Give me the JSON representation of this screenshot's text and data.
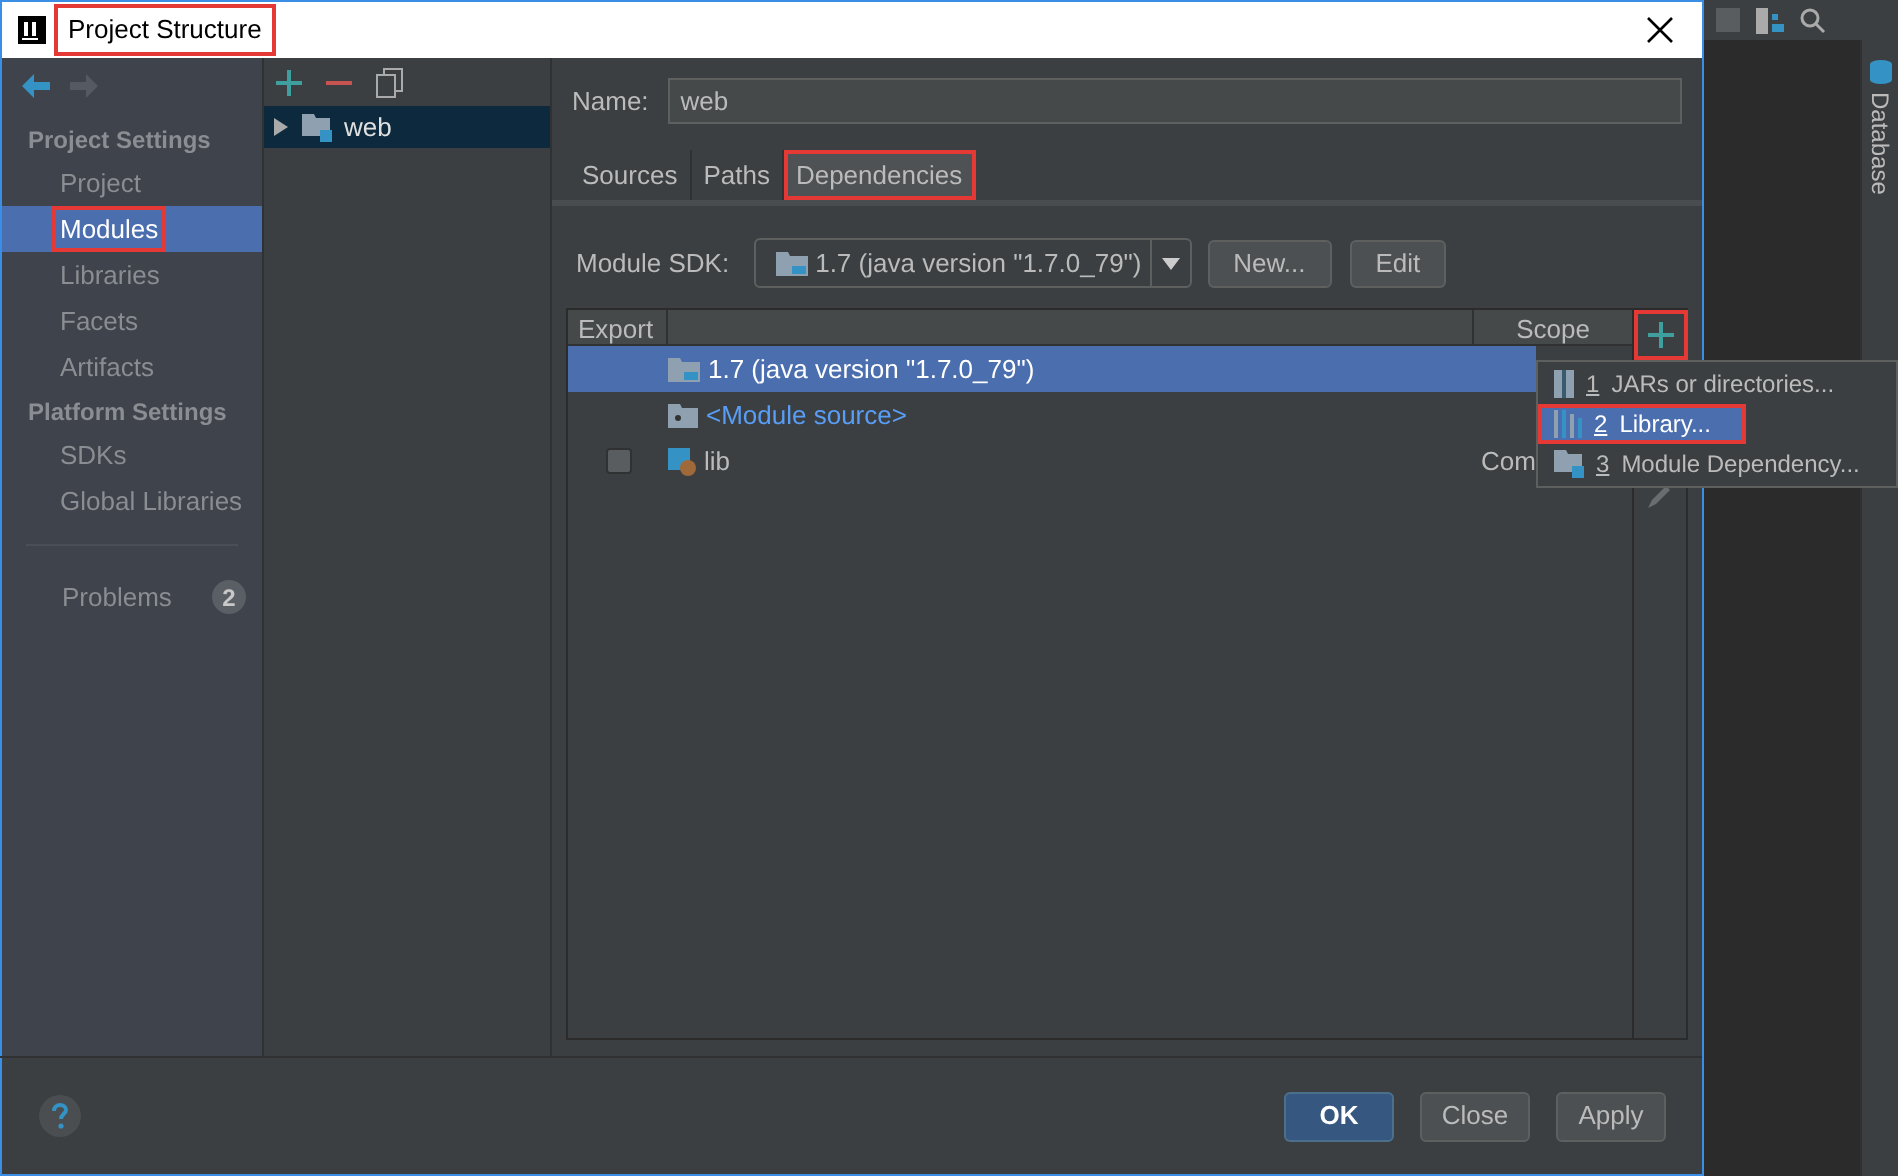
{
  "window": {
    "title": "Project Structure",
    "marked": true
  },
  "sidebar": {
    "sections": [
      {
        "title": "Project Settings",
        "items": [
          {
            "label": "Project",
            "selected": false,
            "marked": false
          },
          {
            "label": "Modules",
            "selected": true,
            "marked": true
          },
          {
            "label": "Libraries",
            "selected": false,
            "marked": false
          },
          {
            "label": "Facets",
            "selected": false,
            "marked": false
          },
          {
            "label": "Artifacts",
            "selected": false,
            "marked": false
          }
        ]
      },
      {
        "title": "Platform Settings",
        "items": [
          {
            "label": "SDKs",
            "selected": false,
            "marked": false
          },
          {
            "label": "Global Libraries",
            "selected": false,
            "marked": false
          }
        ]
      }
    ],
    "problems": {
      "label": "Problems",
      "count": "2"
    }
  },
  "module_tree": [
    {
      "label": "web",
      "expanded": false
    }
  ],
  "name_field": {
    "label": "Name:",
    "value": "web"
  },
  "tabs": [
    {
      "label": "Sources",
      "selected": false,
      "marked": false
    },
    {
      "label": "Paths",
      "selected": false,
      "marked": false
    },
    {
      "label": "Dependencies",
      "selected": true,
      "marked": true
    }
  ],
  "module_sdk": {
    "label": "Module SDK:",
    "value": "1.7 (java version \"1.7.0_79\")"
  },
  "sdk_buttons": [
    "New...",
    "Edit"
  ],
  "table": {
    "columns": [
      "Export",
      "Scope"
    ],
    "add_marked": true,
    "rows": [
      {
        "kind": "sdk",
        "name": "1.7 (java version \"1.7.0_79\")",
        "selected": true
      },
      {
        "kind": "source",
        "name": "<Module source>",
        "selected": false
      },
      {
        "kind": "library",
        "name": "lib",
        "checked": false,
        "scope": "Com",
        "selected": false
      }
    ]
  },
  "add_menu": [
    {
      "number": "1",
      "label": "JARs or directories...",
      "selected": false,
      "marked": false
    },
    {
      "number": "2",
      "label": "Library...",
      "selected": true,
      "marked": true
    },
    {
      "number": "3",
      "label": "Module Dependency...",
      "selected": false,
      "marked": false
    }
  ],
  "buttons": [
    {
      "label": "OK",
      "default": true
    },
    {
      "label": "Close",
      "default": false
    },
    {
      "label": "Apply",
      "default": false
    }
  ],
  "tool_window": {
    "label": "Database"
  }
}
